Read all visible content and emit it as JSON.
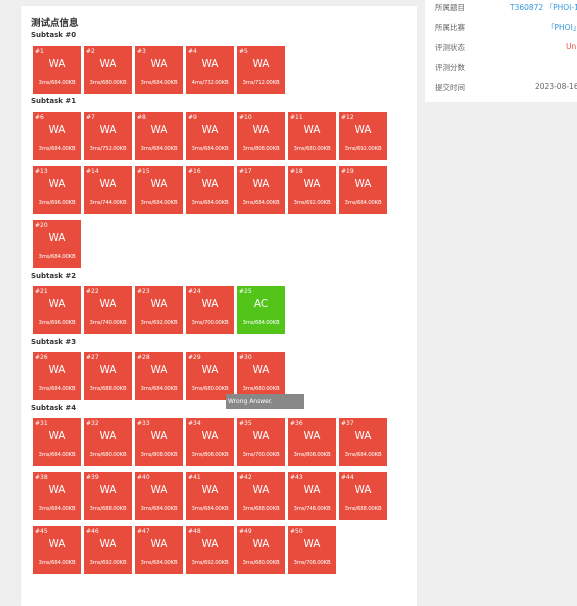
{
  "main": {
    "title": "测试点信息",
    "tooltip": "Wrong Answer.",
    "subtasks": [
      {
        "label": "Subtask #0",
        "cases": [
          {
            "idx": "#1",
            "status": "WA",
            "info": "3ms/684.00KB"
          },
          {
            "idx": "#2",
            "status": "WA",
            "info": "3ms/680.00KB"
          },
          {
            "idx": "#3",
            "status": "WA",
            "info": "3ms/684.00KB"
          },
          {
            "idx": "#4",
            "status": "WA",
            "info": "4ms/732.00KB"
          },
          {
            "idx": "#5",
            "status": "WA",
            "info": "3ms/712.00KB"
          }
        ]
      },
      {
        "label": "Subtask #1",
        "cases": [
          {
            "idx": "#6",
            "status": "WA",
            "info": "3ms/684.00KB"
          },
          {
            "idx": "#7",
            "status": "WA",
            "info": "3ms/752.00KB"
          },
          {
            "idx": "#8",
            "status": "WA",
            "info": "3ms/684.00KB"
          },
          {
            "idx": "#9",
            "status": "WA",
            "info": "3ms/684.00KB"
          },
          {
            "idx": "#10",
            "status": "WA",
            "info": "3ms/808.00KB"
          },
          {
            "idx": "#11",
            "status": "WA",
            "info": "3ms/680.00KB"
          },
          {
            "idx": "#12",
            "status": "WA",
            "info": "3ms/692.00KB"
          },
          {
            "idx": "#13",
            "status": "WA",
            "info": "3ms/696.00KB"
          },
          {
            "idx": "#14",
            "status": "WA",
            "info": "3ms/744.00KB"
          },
          {
            "idx": "#15",
            "status": "WA",
            "info": "3ms/684.00KB"
          },
          {
            "idx": "#16",
            "status": "WA",
            "info": "3ms/684.00KB"
          },
          {
            "idx": "#17",
            "status": "WA",
            "info": "3ms/684.00KB"
          },
          {
            "idx": "#18",
            "status": "WA",
            "info": "3ms/692.00KB"
          },
          {
            "idx": "#19",
            "status": "WA",
            "info": "3ms/684.00KB"
          },
          {
            "idx": "#20",
            "status": "WA",
            "info": "3ms/684.00KB"
          }
        ]
      },
      {
        "label": "Subtask #2",
        "cases": [
          {
            "idx": "#21",
            "status": "WA",
            "info": "3ms/696.00KB"
          },
          {
            "idx": "#22",
            "status": "WA",
            "info": "3ms/740.00KB"
          },
          {
            "idx": "#23",
            "status": "WA",
            "info": "3ms/692.00KB"
          },
          {
            "idx": "#24",
            "status": "WA",
            "info": "3ms/700.00KB"
          },
          {
            "idx": "#25",
            "status": "AC",
            "info": "3ms/684.00KB"
          }
        ]
      },
      {
        "label": "Subtask #3",
        "cases": [
          {
            "idx": "#26",
            "status": "WA",
            "info": "3ms/684.00KB"
          },
          {
            "idx": "#27",
            "status": "WA",
            "info": "3ms/688.00KB"
          },
          {
            "idx": "#28",
            "status": "WA",
            "info": "3ms/684.00KB"
          },
          {
            "idx": "#29",
            "status": "WA",
            "info": "3ms/680.00KB"
          },
          {
            "idx": "#30",
            "status": "WA",
            "info": "3ms/680.00KB"
          }
        ]
      },
      {
        "label": "Subtask #4",
        "cases": [
          {
            "idx": "#31",
            "status": "WA",
            "info": "3ms/684.00KB"
          },
          {
            "idx": "#32",
            "status": "WA",
            "info": "3ms/680.00KB"
          },
          {
            "idx": "#33",
            "status": "WA",
            "info": "3ms/808.00KB"
          },
          {
            "idx": "#34",
            "status": "WA",
            "info": "3ms/808.00KB"
          },
          {
            "idx": "#35",
            "status": "WA",
            "info": "3ms/700.00KB"
          },
          {
            "idx": "#36",
            "status": "WA",
            "info": "3ms/808.00KB"
          },
          {
            "idx": "#37",
            "status": "WA",
            "info": "3ms/684.00KB"
          },
          {
            "idx": "#38",
            "status": "WA",
            "info": "3ms/684.00KB"
          },
          {
            "idx": "#39",
            "status": "WA",
            "info": "3ms/688.00KB"
          },
          {
            "idx": "#40",
            "status": "WA",
            "info": "3ms/684.00KB"
          },
          {
            "idx": "#41",
            "status": "WA",
            "info": "3ms/684.00KB"
          },
          {
            "idx": "#42",
            "status": "WA",
            "info": "3ms/688.00KB"
          },
          {
            "idx": "#43",
            "status": "WA",
            "info": "3ms/748.00KB"
          },
          {
            "idx": "#44",
            "status": "WA",
            "info": "3ms/688.00KB"
          },
          {
            "idx": "#45",
            "status": "WA",
            "info": "3ms/684.00KB"
          },
          {
            "idx": "#46",
            "status": "WA",
            "info": "3ms/692.00KB"
          },
          {
            "idx": "#47",
            "status": "WA",
            "info": "3ms/684.00KB"
          },
          {
            "idx": "#48",
            "status": "WA",
            "info": "3ms/692.00KB"
          },
          {
            "idx": "#49",
            "status": "WA",
            "info": "3ms/680.00KB"
          },
          {
            "idx": "#50",
            "status": "WA",
            "info": "3ms/708.00KB"
          }
        ]
      }
    ]
  },
  "sidebar": {
    "problem_label": "所属题目",
    "problem_value": "T360872 「PHOI-1",
    "contest_label": "所属比赛",
    "contest_value": "「PHOI」",
    "status_label": "评测状态",
    "status_value": "Un",
    "score_label": "评测分数",
    "time_label": "提交时间",
    "time_value": "2023-08-16"
  },
  "colors": {
    "wa": "#e74c3c",
    "ac": "#52c41a",
    "link": "#3498db",
    "page_bg": "#efefef",
    "card_bg": "#ffffff"
  }
}
